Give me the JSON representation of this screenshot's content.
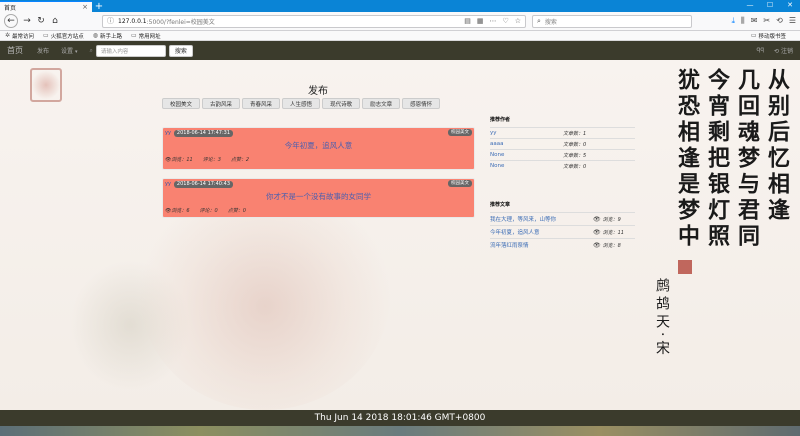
{
  "browser": {
    "tab_title": "首页",
    "tab_close": "×",
    "new_tab": "+",
    "window_controls": [
      "—",
      "☐",
      "✕"
    ],
    "url_host": "127.0.0.1",
    "url_path": ":5000/?fenlei=校园美文",
    "search_placeholder": "搜索",
    "bookmarks": [
      "最常访问",
      "火狐官方站点",
      "新手上路",
      "常用网址"
    ],
    "bookmarks_right": "移动版书签"
  },
  "site_nav": {
    "brand": "首页",
    "links": [
      "发布"
    ],
    "settings_label": "设置",
    "search_placeholder": "请输入内容",
    "search_button": "搜索",
    "user": "qq",
    "logout": "注销"
  },
  "main": {
    "title": "发布",
    "category_tabs": [
      "校园美文",
      "古韵风采",
      "青春风采",
      "人生感悟",
      "现代诗歌",
      "励志文章",
      "感恩情怀"
    ],
    "posts": [
      {
        "author": "yy",
        "date": "2018-06-14 17:47:31",
        "category": "校园美文",
        "title": "今年初夏，追风人意",
        "views": "浏览：11",
        "comments": "评论：3",
        "likes": "点赞：2"
      },
      {
        "author": "yy",
        "date": "2018-06-14 17:40:43",
        "category": "校园美文",
        "title": "你才不是一个没有故事的女同学",
        "views": "浏览：6",
        "comments": "评论：0",
        "likes": "点赞：0"
      }
    ]
  },
  "sidebar": {
    "authors_title": "推荐作者",
    "authors": [
      {
        "name": "yy",
        "count": "文章数：1"
      },
      {
        "name": "aaaa",
        "count": "文章数：0"
      },
      {
        "name": "None",
        "count": "文章数：5"
      },
      {
        "name": "None",
        "count": "文章数：0"
      }
    ],
    "articles_title": "推荐文章",
    "articles": [
      {
        "title": "我在大理，等风来，山等你",
        "views": "浏览：9"
      },
      {
        "title": "今年初夏，追风人意",
        "views": "浏览：11"
      },
      {
        "title": "流年落红雨祭情",
        "views": "浏览：8"
      }
    ]
  },
  "footer": {
    "datetime": "Thu Jun 14 2018 18:01:46 GMT+0800"
  }
}
